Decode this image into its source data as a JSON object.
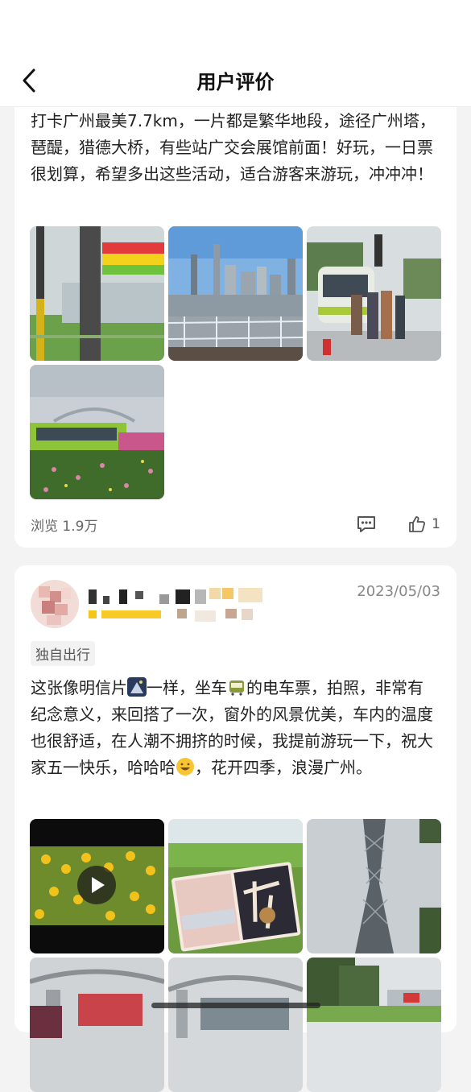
{
  "header": {
    "title": "用户评价"
  },
  "review1": {
    "text": "打卡广州最美7.7km，一片都是繁华地段，途径广州塔，琶醍，猎德大桥，有些站广交会展馆前面！好玩，一日票很划算，希望多出这些活动，适合游客来游玩，冲冲冲！",
    "views": "浏览 1.9万",
    "likes": "1"
  },
  "review2": {
    "date": "2023/05/03",
    "tag": "独自出行",
    "text_parts": [
      "这张像明信片",
      "一样，坐车",
      "的电车票，拍照，非常有纪念意义，来回搭了一次，窗外的风景优美，车内的温度也很舒适，在人潮不拥挤的时候，我提前游玩一下，祝大家五一快乐，哈哈哈",
      "，花开四季，浪漫广州。"
    ]
  },
  "icons": {
    "back": "chevron-left-icon",
    "comment": "comment-icon",
    "like": "thumbs-up-icon",
    "play": "play-icon"
  }
}
